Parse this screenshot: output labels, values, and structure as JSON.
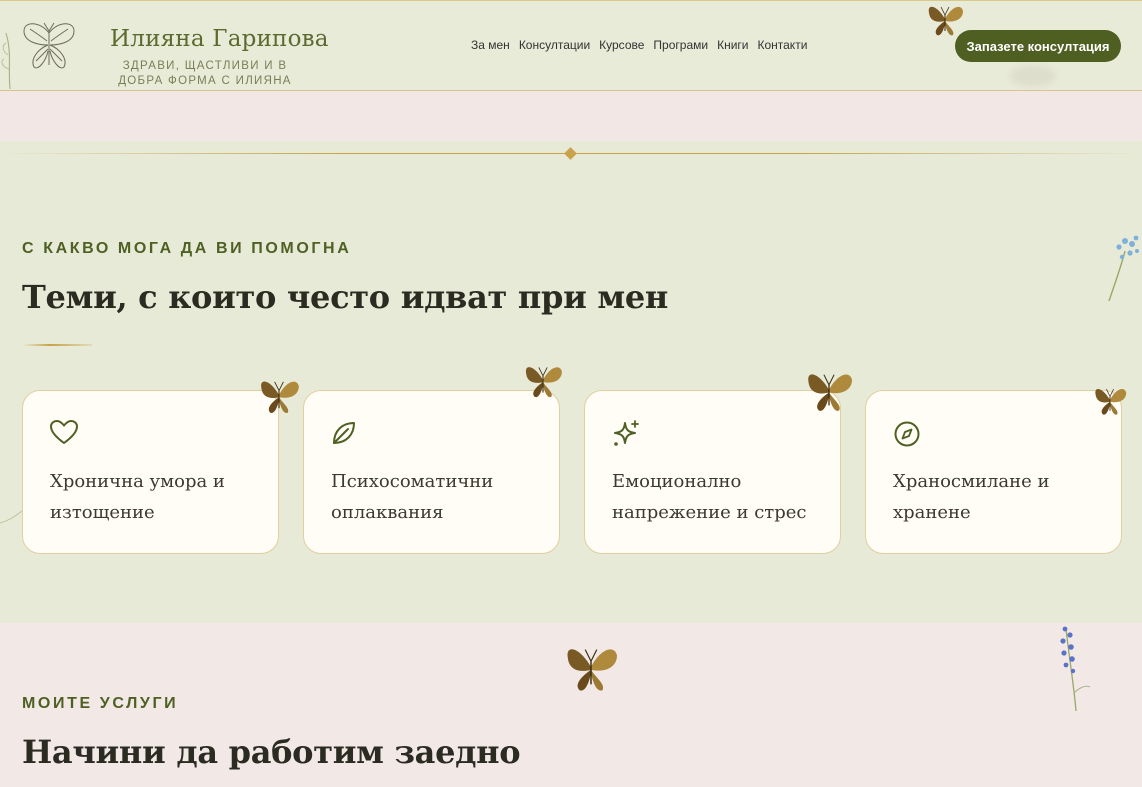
{
  "brand": {
    "name": "Илияна Гарипова",
    "tagline": "ЗДРАВИ, ЩАСТЛИВИ И В ДОБРА ФОРМА С ИЛИЯНА"
  },
  "nav": {
    "items": [
      "За мен",
      "Консултации",
      "Курсове",
      "Програми",
      "Книги",
      "Контакти"
    ]
  },
  "header": {
    "cta_label": "Запазете консултация"
  },
  "help_section": {
    "eyebrow": "С КАКВО МОГА ДА ВИ ПОМОГНА",
    "title": "Теми, с които често идват при мен",
    "cards": [
      {
        "icon": "heart-icon",
        "text": "Хронична умора и изтощение"
      },
      {
        "icon": "leaf-icon",
        "text": "Психосоматични оплаквания"
      },
      {
        "icon": "sparkle-icon",
        "text": "Емоционално напрежение и стрес"
      },
      {
        "icon": "compass-icon",
        "text": "Храносмилане и хранене"
      }
    ]
  },
  "services_section": {
    "eyebrow": "МОИТЕ УСЛУГИ",
    "title": "Начини да работим заедно"
  },
  "colors": {
    "accent_green": "#4f5f22",
    "gold": "#c9a24a",
    "bg_sage": "#e7ead7",
    "bg_pink": "#f3e7e6",
    "card_bg": "#fffdf6"
  }
}
